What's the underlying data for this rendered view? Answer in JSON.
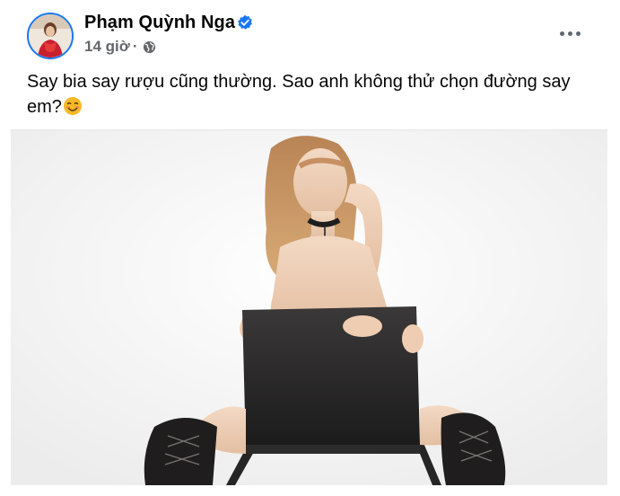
{
  "post": {
    "author": "Phạm Quỳnh Nga",
    "time": "14 giờ",
    "separator": "·",
    "caption_text": "Say bia say rượu cũng thường. Sao anh không thử chọn đường say em?",
    "caption_emoji_icon": "smiling-face-icon",
    "privacy_icon": "globe-icon",
    "verified_icon": "verified-badge-icon",
    "more_icon": "more-options-icon"
  },
  "photo": {
    "icon": "photo-image",
    "description_text": ""
  },
  "colors": {
    "accent": "#1877f2",
    "text": "#050505",
    "secondary_text": "#65676b"
  }
}
